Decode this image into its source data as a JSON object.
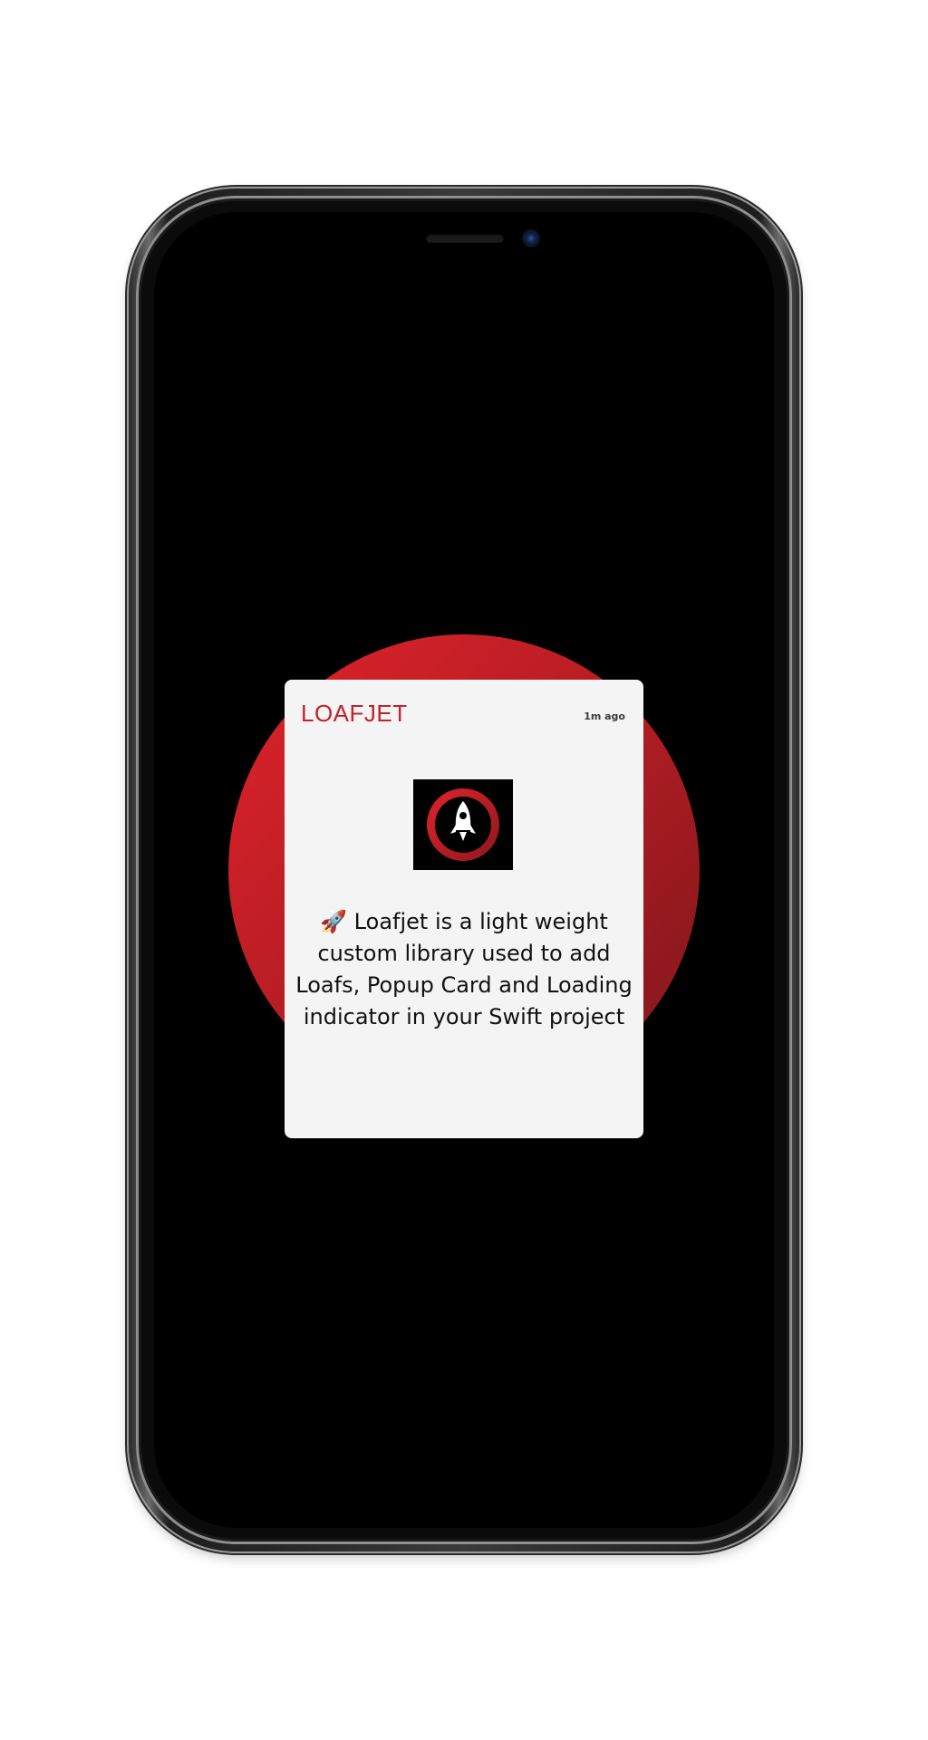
{
  "device": {
    "type": "phone-mockup",
    "frame_color": "#1d1d1d",
    "screen_color": "#000000"
  },
  "background": {
    "circle_color_start": "#e0232b",
    "circle_color_end": "#7c171b"
  },
  "card": {
    "title": "LOAFJET",
    "timestamp": "1m ago",
    "logo_icon": "rocket-icon",
    "message": "🚀 Loafjet is a light weight custom library used to add Loafs, Popup Card and Loading indicator in your Swift project",
    "title_color": "#c4212b",
    "background_color": "#f4f4f4"
  }
}
